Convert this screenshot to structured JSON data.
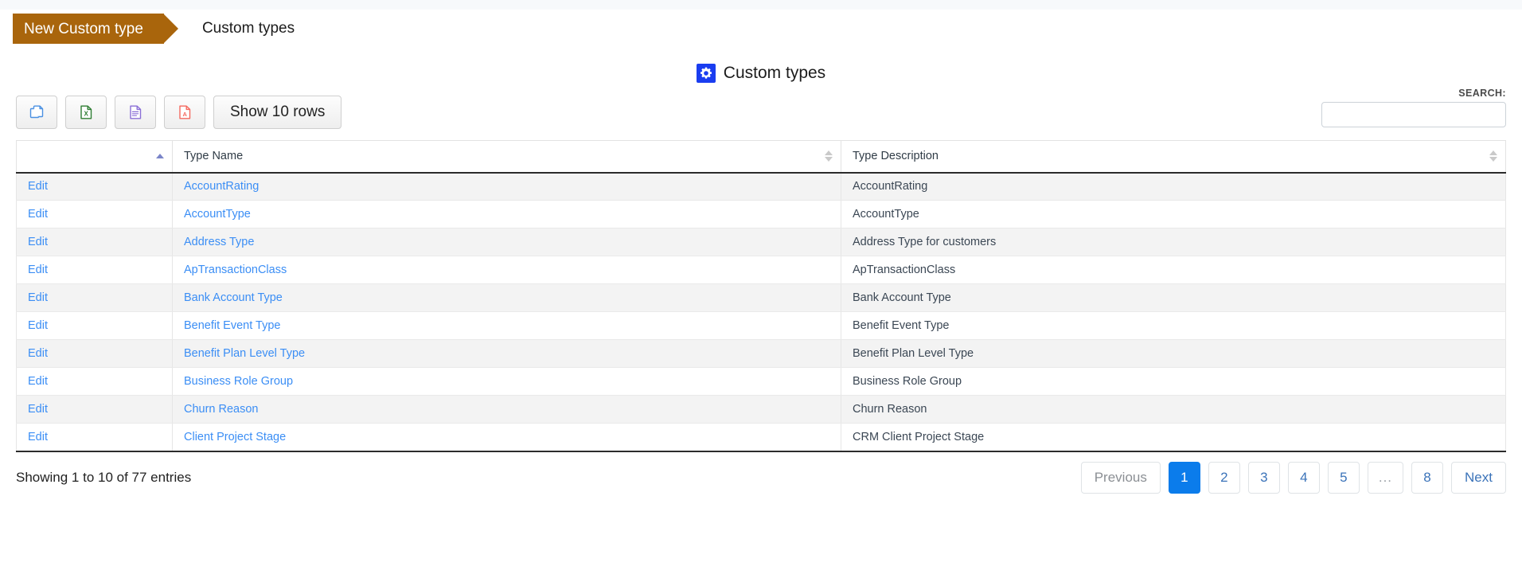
{
  "breadcrumb": {
    "action_label": "New Custom type",
    "current_label": "Custom types"
  },
  "page": {
    "title": "Custom types",
    "title_icon": "gear-icon",
    "accent_brown": "#a9650c",
    "accent_blue": "#0b7ceb",
    "link_blue": "#3b8ef5",
    "title_badge_blue": "#1a3df0"
  },
  "toolbar": {
    "buttons": [
      {
        "name": "copy-button",
        "icon": "copy-icon",
        "label": ""
      },
      {
        "name": "excel-export-button",
        "icon": "excel-icon",
        "label": ""
      },
      {
        "name": "csv-export-button",
        "icon": "document-icon",
        "label": ""
      },
      {
        "name": "pdf-export-button",
        "icon": "pdf-icon",
        "label": ""
      }
    ],
    "show_rows_label": "Show 10 rows"
  },
  "search": {
    "label": "SEARCH:",
    "value": "",
    "placeholder": ""
  },
  "table": {
    "columns": [
      {
        "label": "",
        "sort": "asc"
      },
      {
        "label": "Type Name",
        "sort": "none"
      },
      {
        "label": "Type Description",
        "sort": "none"
      }
    ],
    "edit_label": "Edit",
    "rows": [
      {
        "action": "Edit",
        "name": "AccountRating",
        "description": "AccountRating"
      },
      {
        "action": "Edit",
        "name": "AccountType",
        "description": "AccountType"
      },
      {
        "action": "Edit",
        "name": "Address Type",
        "description": "Address Type for customers"
      },
      {
        "action": "Edit",
        "name": "ApTransactionClass",
        "description": "ApTransactionClass"
      },
      {
        "action": "Edit",
        "name": "Bank Account Type",
        "description": "Bank Account Type"
      },
      {
        "action": "Edit",
        "name": "Benefit Event Type",
        "description": "Benefit Event Type"
      },
      {
        "action": "Edit",
        "name": "Benefit Plan Level Type",
        "description": "Benefit Plan Level Type"
      },
      {
        "action": "Edit",
        "name": "Business Role Group",
        "description": "Business Role Group"
      },
      {
        "action": "Edit",
        "name": "Churn Reason",
        "description": "Churn Reason"
      },
      {
        "action": "Edit",
        "name": "Client Project Stage",
        "description": "CRM Client Project Stage"
      }
    ]
  },
  "footer": {
    "showing_info": "Showing 1 to 10 of 77 entries",
    "pagination": {
      "previous_label": "Previous",
      "next_label": "Next",
      "ellipsis_label": "...",
      "active_page": "1",
      "pages": [
        "1",
        "2",
        "3",
        "4",
        "5",
        "...",
        "8"
      ]
    }
  }
}
